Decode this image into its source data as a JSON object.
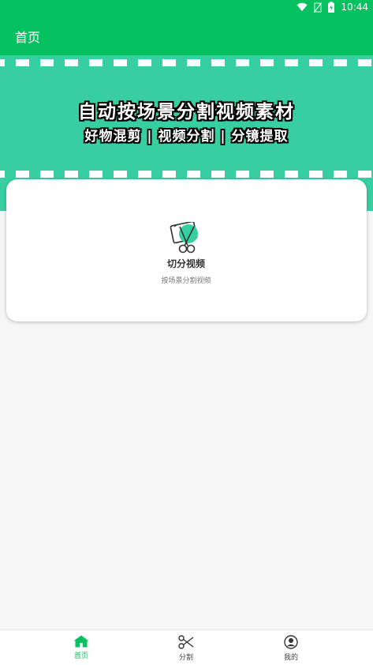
{
  "status_bar": {
    "time": "10:44",
    "icons": [
      "wifi-icon",
      "no-sim-icon",
      "battery-charging-icon"
    ]
  },
  "app_bar": {
    "title": "首页"
  },
  "banner": {
    "headline": "自动按场景分割视频素材",
    "tagline": "好物混剪 | 视频分割 | 分镜提取",
    "background_color": "#37cfa1"
  },
  "features": [
    {
      "title": "切分视频",
      "subtitle": "按场景分割视频",
      "icon": "video-scissors-icon"
    }
  ],
  "bottom_nav": {
    "items": [
      {
        "label": "首页",
        "icon": "home-icon",
        "active": true
      },
      {
        "label": "分割",
        "icon": "scissors-icon",
        "active": false
      },
      {
        "label": "我的",
        "icon": "profile-icon",
        "active": false
      }
    ]
  },
  "colors": {
    "primary": "#06c160",
    "page_background": "#f6f6f6"
  }
}
